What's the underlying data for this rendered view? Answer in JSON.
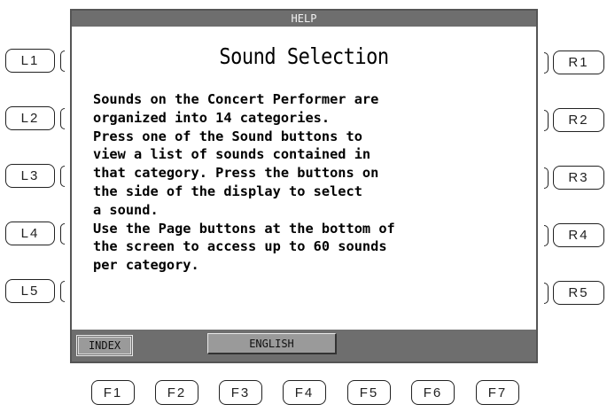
{
  "screen": {
    "title": "HELP",
    "heading": "Sound Selection",
    "body_lines": [
      "Sounds on the Concert Performer are",
      "organized into 14 categories.",
      "Press one of the Sound buttons to",
      "view a list of sounds contained in",
      "that category. Press the buttons on",
      "the side of the display to select",
      "a sound.",
      "Use the Page buttons at the bottom of",
      "the screen to access up to 60 sounds",
      "per category."
    ],
    "bottom_bar": {
      "index_label": "INDEX",
      "language_label": "ENGLISH"
    }
  },
  "left_buttons": [
    "L1",
    "L2",
    "L3",
    "L4",
    "L5"
  ],
  "right_buttons": [
    "R1",
    "R2",
    "R3",
    "R4",
    "R5"
  ],
  "function_buttons": [
    "F1",
    "F2",
    "F3",
    "F4",
    "F5",
    "F6",
    "F7"
  ],
  "colors": {
    "lcd_bar": "#6e6e6e",
    "lcd_background": "#ffffff",
    "text": "#000000"
  }
}
